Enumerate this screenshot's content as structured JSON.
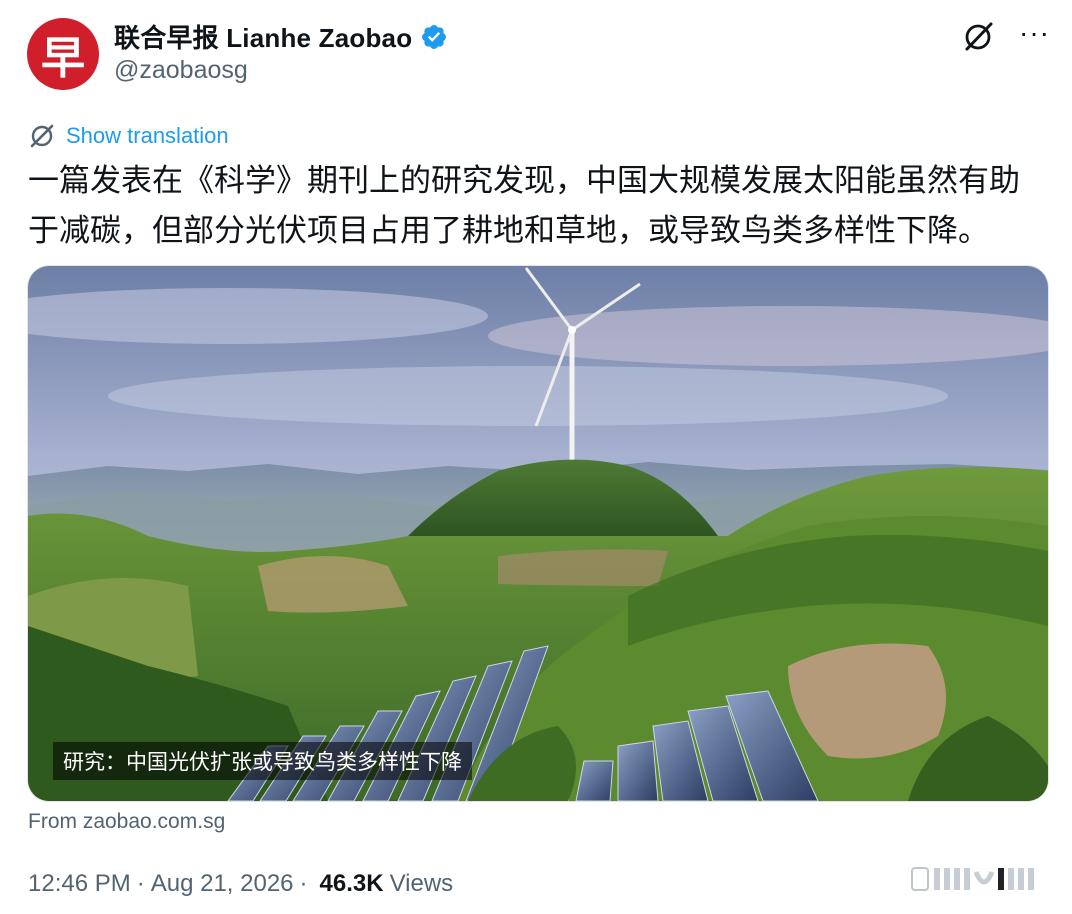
{
  "account": {
    "display_name": "联合早报 Lianhe Zaobao",
    "handle": "@zaobaosg",
    "avatar_char": "早",
    "verified": true
  },
  "tweet": {
    "show_translation": "Show translation",
    "text": "一篇发表在《科学》期刊上的研究发现，中国大规模发展太阳能虽然有助于减碳，但部分光伏项目占用了耕地和草地，或导致鸟类多样性下降。",
    "media_caption": "研究：中国光伏扩张或导致鸟类多样性下降",
    "link_source": "From zaobao.com.sg",
    "time": "12:46 PM",
    "date": "Aug 21, 2026",
    "separator": "·",
    "views_count": "46.3K",
    "views_label": "Views"
  },
  "colors": {
    "accent": "#1d9bf0",
    "avatar_bg": "#d01f2a",
    "muted_text": "#536471"
  }
}
